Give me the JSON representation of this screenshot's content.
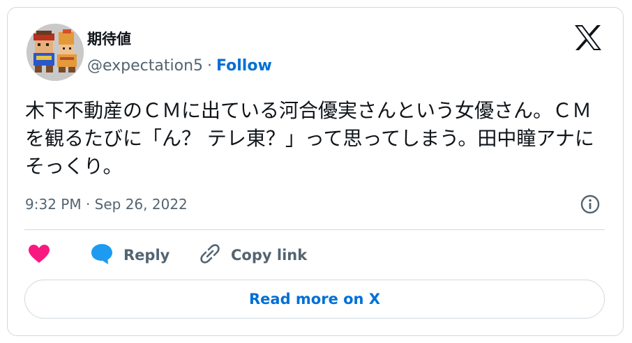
{
  "author": {
    "display_name": "期待値",
    "handle": "@expectation5",
    "separator": "·",
    "follow_label": "Follow"
  },
  "tweet": {
    "text": "木下不動産のＣＭに出ている河合優実さんという女優さん。ＣＭを観るたびに「ん？ テレ東？」って思ってしまう。田中瞳アナにそっくり。",
    "timestamp": "9:32 PM · Sep 26, 2022"
  },
  "actions": {
    "reply_label": "Reply",
    "copy_link_label": "Copy link"
  },
  "read_more_label": "Read more on X",
  "icons": {
    "brand": "x-logo-icon",
    "info": "info-icon",
    "like": "heart-icon",
    "reply": "speech-bubble-icon",
    "copy": "link-icon"
  },
  "colors": {
    "accent": "#006fd6",
    "like": "#f91880",
    "reply": "#1d9bf0",
    "muted_text": "#536471",
    "border": "#cfd9de"
  }
}
